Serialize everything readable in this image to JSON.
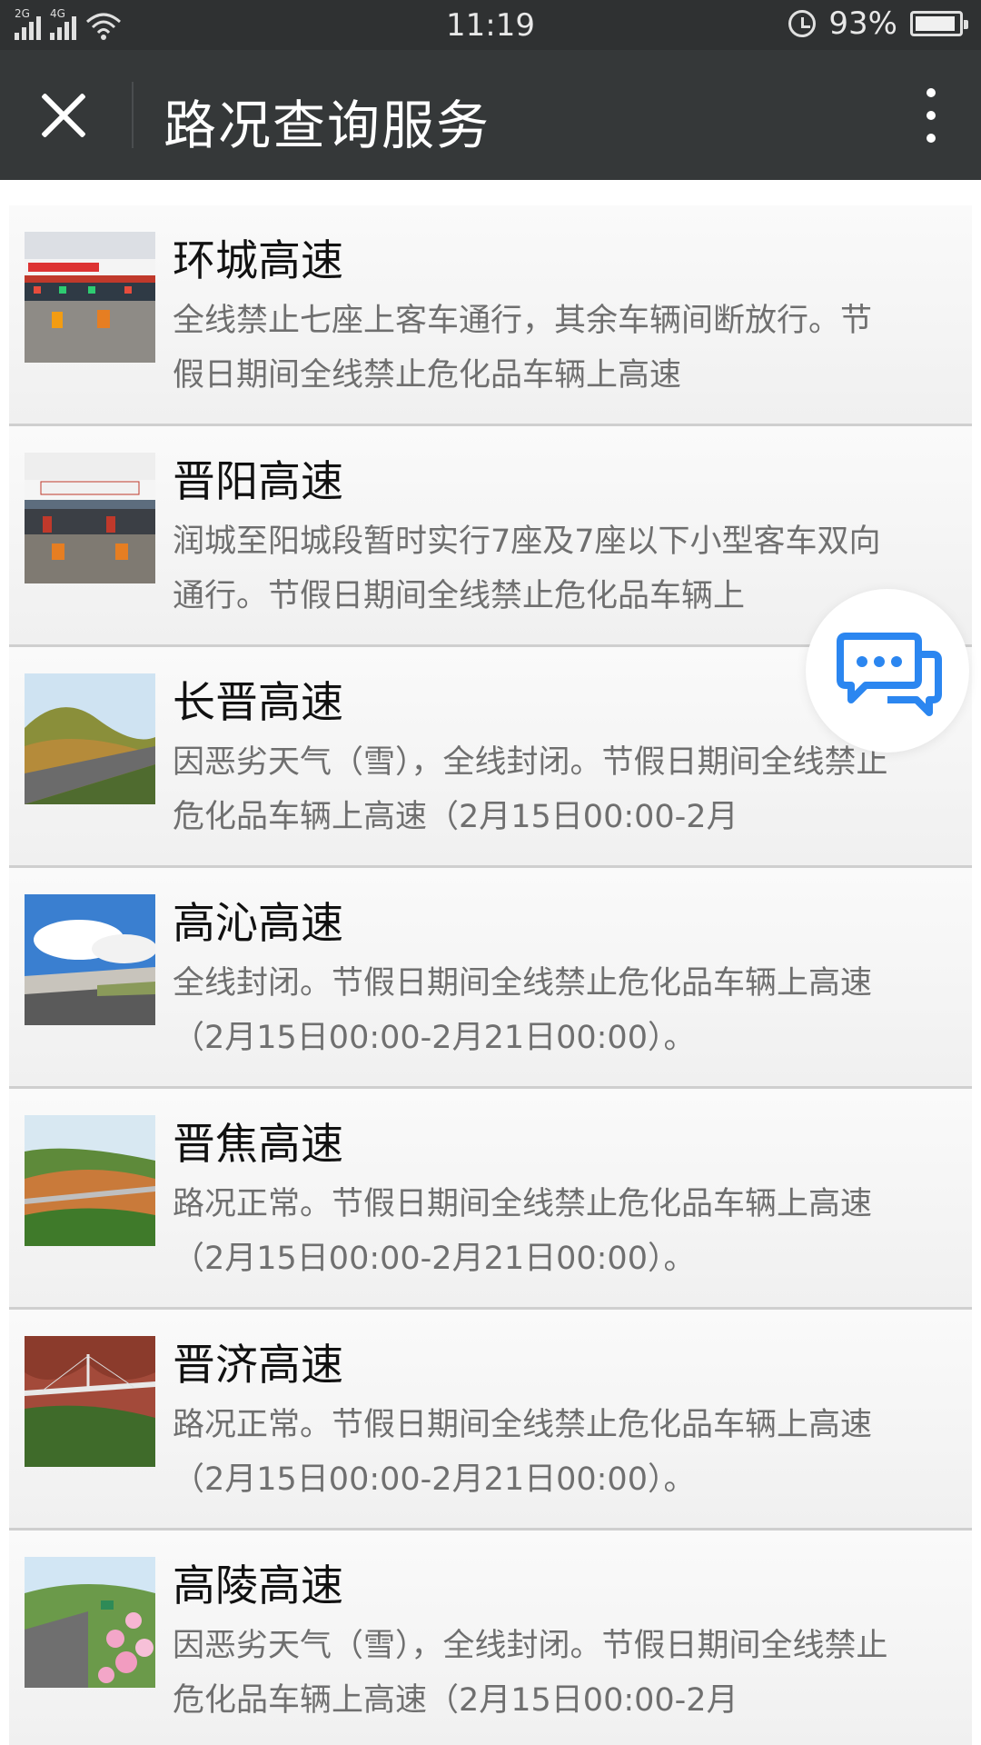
{
  "status_bar": {
    "network_left": "2G",
    "network_right": "4G",
    "time": "11:19",
    "battery": "93%",
    "battery_level": 0.93
  },
  "header": {
    "title": "路况查询服务"
  },
  "roads": [
    {
      "name": "环城高速",
      "desc": "全线禁止七座上客车通行，其余车辆间断放行。节假日期间全线禁止危化品车辆上高速",
      "image": "toll-station-photo"
    },
    {
      "name": "晋阳高速",
      "desc": "润城至阳城段暂时实行7座及7座以下小型客车双向通行。节假日期间全线禁止危化品车辆上",
      "image": "toll-station-photo"
    },
    {
      "name": "长晋高速",
      "desc": "因恶劣天气（雪），全线封闭。节假日期间全线禁止危化品车辆上高速（2月15日00:00-2月",
      "image": "mountain-highway-photo"
    },
    {
      "name": "高沁高速",
      "desc": "全线封闭。节假日期间全线禁止危化品车辆上高速（2月15日00:00-2月21日00:00）。",
      "image": "tunnel-highway-photo"
    },
    {
      "name": "晋焦高速",
      "desc": "路况正常。节假日期间全线禁止危化品车辆上高速（2月15日00:00-2月21日00:00）。",
      "image": "viaduct-photo"
    },
    {
      "name": "晋济高速",
      "desc": "路况正常。节假日期间全线禁止危化品车辆上高速（2月15日00:00-2月21日00:00）。",
      "image": "bridge-canyon-photo"
    },
    {
      "name": "高陵高速",
      "desc": "因恶劣天气（雪），全线封闭。节假日期间全线禁止危化品车辆上高速（2月15日00:00-2月",
      "image": "flower-highway-photo"
    }
  ],
  "colors": {
    "status_bar_bg": "#2f3132",
    "header_bg": "#353839",
    "chat_icon": "#2b86f0"
  }
}
